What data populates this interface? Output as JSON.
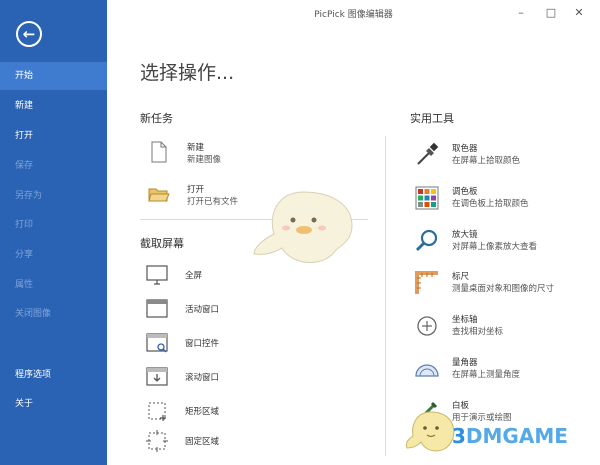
{
  "app": {
    "title": "PicPick 图像编辑器"
  },
  "window_controls": {
    "minimize": "–",
    "maximize": "□",
    "close": "✕"
  },
  "sidebar": {
    "items": [
      {
        "label": "开始",
        "state": "selected"
      },
      {
        "label": "新建",
        "state": "normal"
      },
      {
        "label": "打开",
        "state": "normal"
      },
      {
        "label": "保存",
        "state": "disabled"
      },
      {
        "label": "另存为",
        "state": "disabled"
      },
      {
        "label": "打印",
        "state": "disabled"
      },
      {
        "label": "分享",
        "state": "disabled"
      },
      {
        "label": "属性",
        "state": "disabled"
      },
      {
        "label": "关闭图像",
        "state": "disabled"
      },
      {
        "label": "程序选项",
        "state": "normal"
      },
      {
        "label": "关于",
        "state": "normal"
      }
    ]
  },
  "main": {
    "heading": "选择操作...",
    "new_task": {
      "title": "新任务",
      "items": [
        {
          "title": "新建",
          "desc": "新建图像",
          "icon": "new-document-icon"
        },
        {
          "title": "打开",
          "desc": "打开已有文件",
          "icon": "open-folder-icon"
        }
      ]
    },
    "capture": {
      "title": "截取屏幕",
      "items": [
        {
          "label": "全屏",
          "icon": "monitor-icon"
        },
        {
          "label": "活动窗口",
          "icon": "active-window-icon"
        },
        {
          "label": "窗口控件",
          "icon": "window-control-icon"
        },
        {
          "label": "滚动窗口",
          "icon": "scroll-window-icon"
        },
        {
          "label": "矩形区域",
          "icon": "rect-region-icon"
        },
        {
          "label": "固定区域",
          "icon": "fixed-region-icon"
        }
      ]
    },
    "tools": {
      "title": "实用工具",
      "items": [
        {
          "title": "取色器",
          "desc": "在屏幕上拾取颜色",
          "icon": "eyedropper-icon"
        },
        {
          "title": "调色板",
          "desc": "在调色板上拾取颜色",
          "icon": "palette-icon"
        },
        {
          "title": "放大镜",
          "desc": "对屏幕上像素放大查看",
          "icon": "magnifier-icon"
        },
        {
          "title": "标尺",
          "desc": "测量桌面对象和图像的尺寸",
          "icon": "ruler-icon"
        },
        {
          "title": "坐标轴",
          "desc": "查找相对坐标",
          "icon": "crosshair-icon"
        },
        {
          "title": "量角器",
          "desc": "在屏幕上测量角度",
          "icon": "protractor-icon"
        },
        {
          "title": "白板",
          "desc": "用于演示或绘图",
          "icon": "whiteboard-pen-icon"
        }
      ]
    }
  },
  "watermark": {
    "three": "3",
    "rest": "DMGAME"
  },
  "colors": {
    "sidebar": "#2b63b4",
    "selected": "#3f7cd0",
    "disabled_text": "#7ea3d9"
  }
}
